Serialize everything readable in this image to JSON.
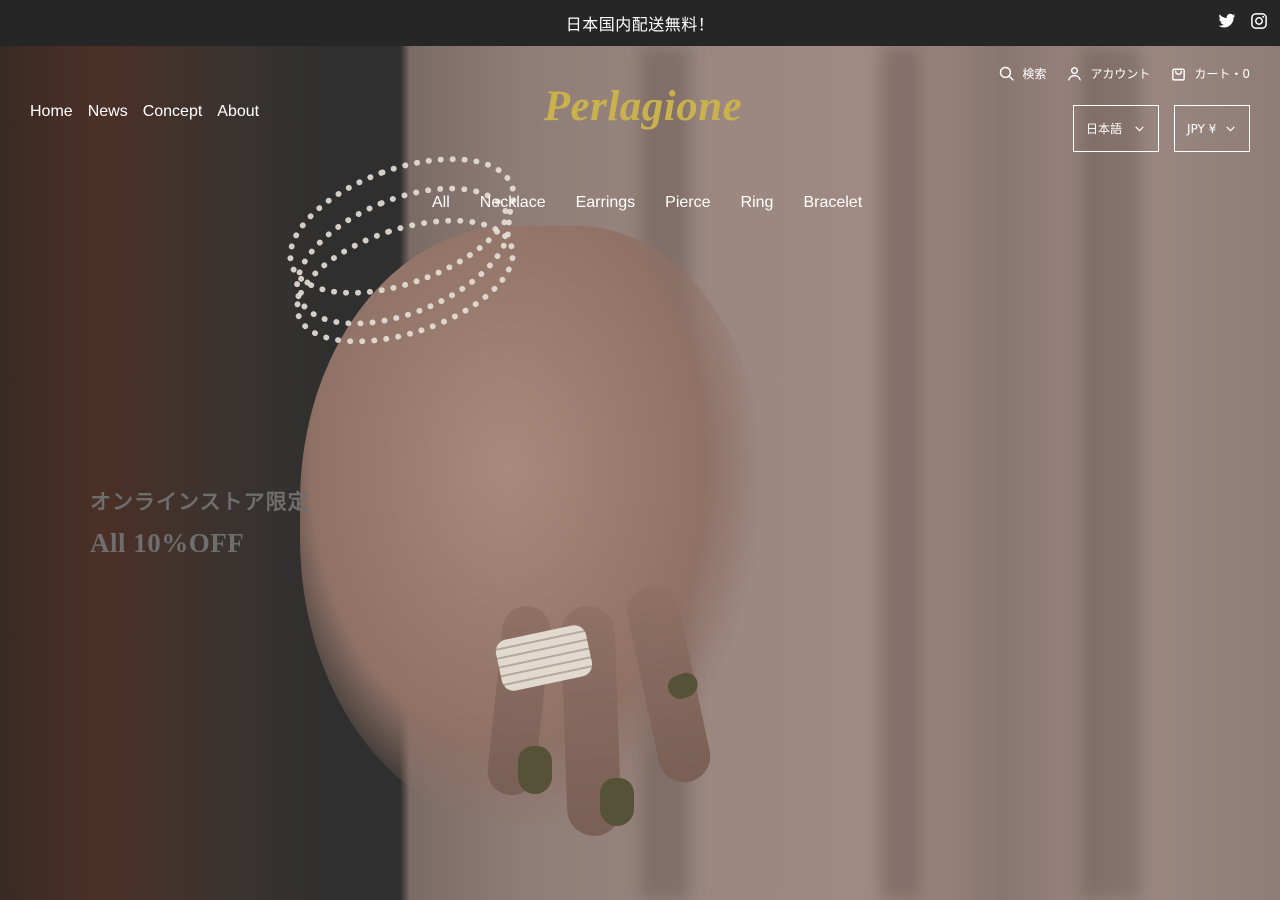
{
  "announcement": {
    "text": "日本国内配送無料！"
  },
  "social": {
    "icons": [
      "twitter-icon",
      "instagram-icon"
    ]
  },
  "nav_left": [
    "Home",
    "News",
    "Concept",
    "About"
  ],
  "logo": "Perlagione",
  "categories": [
    "All",
    "Necklace",
    "Earrings",
    "Pierce",
    "Ring",
    "Bracelet"
  ],
  "utility": {
    "search": "検索",
    "account": "アカウント",
    "cart": "カート・0"
  },
  "selects": {
    "language": "日本語",
    "currency": "JPY ¥"
  },
  "promo": {
    "line1": "オンラインストア限定",
    "line2": "All 10%OFF"
  },
  "colors": {
    "topbar": "#262626",
    "logo": "#c9b24e",
    "nail": "#565238"
  }
}
